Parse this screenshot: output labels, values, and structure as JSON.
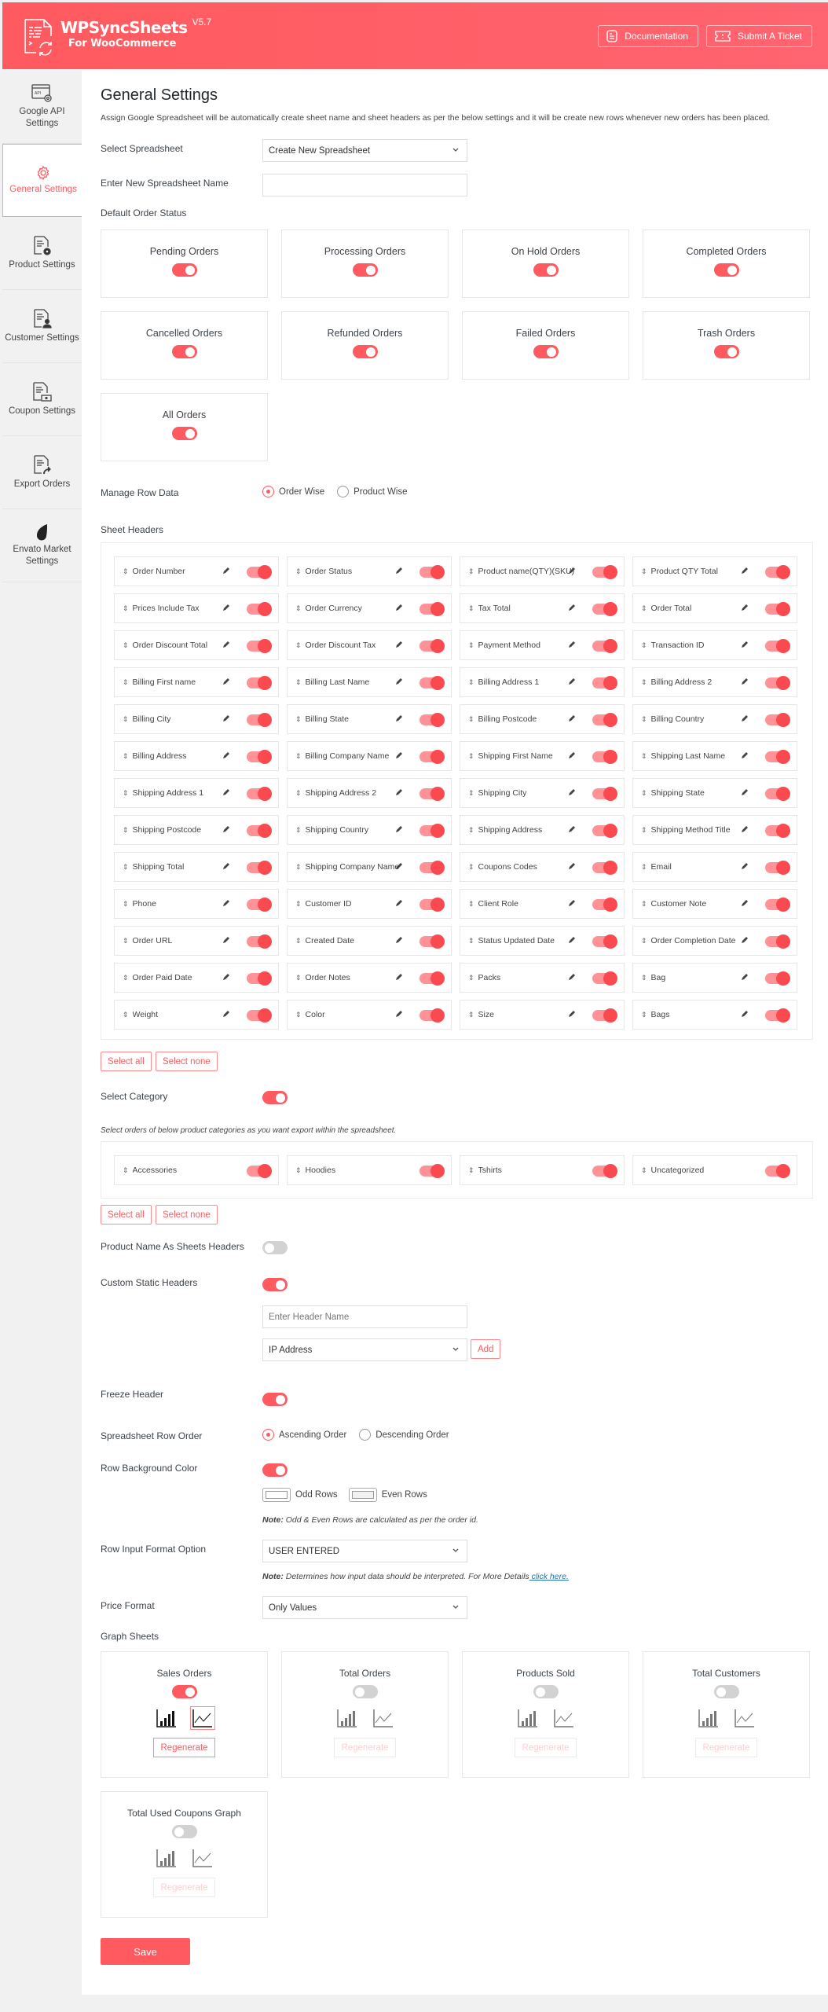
{
  "header": {
    "brand": "WPSyncSheets",
    "subtitle": "For WooCommerce",
    "version": "V5.7",
    "documentation_label": "Documentation",
    "ticket_label": "Submit A Ticket",
    "accent_color": "#ff5a5f"
  },
  "sidebar": {
    "items": [
      {
        "label": "Google API Settings",
        "icon": "api-settings-icon",
        "active": false
      },
      {
        "label": "General Settings",
        "icon": "gear-icon",
        "active": true
      },
      {
        "label": "Product Settings",
        "icon": "product-doc-icon",
        "active": false
      },
      {
        "label": "Customer Settings",
        "icon": "customer-doc-icon",
        "active": false
      },
      {
        "label": "Coupon Settings",
        "icon": "coupon-doc-icon",
        "active": false
      },
      {
        "label": "Export Orders",
        "icon": "export-doc-icon",
        "active": false
      },
      {
        "label": "Envato Market Settings",
        "icon": "envato-leaf-icon",
        "active": false
      }
    ]
  },
  "main": {
    "title": "General Settings",
    "description": "Assign Google Spreadsheet will be automatically create sheet name and sheet headers as per the below settings and it will be create new rows whenever new orders has been placed.",
    "select_spreadsheet": {
      "label": "Select Spreadsheet",
      "value": "Create New Spreadsheet"
    },
    "new_spreadsheet_name": {
      "label": "Enter New Spreadsheet Name",
      "value": ""
    },
    "default_order_status": {
      "label": "Default Order Status",
      "items": [
        {
          "label": "Pending Orders",
          "on": true
        },
        {
          "label": "Processing Orders",
          "on": true
        },
        {
          "label": "On Hold Orders",
          "on": true
        },
        {
          "label": "Completed Orders",
          "on": true
        },
        {
          "label": "Cancelled Orders",
          "on": true
        },
        {
          "label": "Refunded Orders",
          "on": true
        },
        {
          "label": "Failed Orders",
          "on": true
        },
        {
          "label": "Trash Orders",
          "on": true
        },
        {
          "label": "All Orders",
          "on": true
        }
      ]
    },
    "manage_row_data": {
      "label": "Manage Row Data",
      "options": [
        "Order Wise",
        "Product Wise"
      ],
      "selected": "Order Wise"
    },
    "sheet_headers": {
      "label": "Sheet Headers",
      "items": [
        "Order Number",
        "Order Status",
        "Product name(QTY)(SKU)",
        "Product QTY Total",
        "Prices Include Tax",
        "Order Currency",
        "Tax Total",
        "Order Total",
        "Order Discount Total",
        "Order Discount Tax",
        "Payment Method",
        "Transaction ID",
        "Billing First name",
        "Billing Last Name",
        "Billing Address 1",
        "Billing Address 2",
        "Billing City",
        "Billing State",
        "Billing Postcode",
        "Billing Country",
        "Billing Address",
        "Billing Company Name",
        "Shipping First Name",
        "Shipping Last Name",
        "Shipping Address 1",
        "Shipping Address 2",
        "Shipping City",
        "Shipping State",
        "Shipping Postcode",
        "Shipping Country",
        "Shipping Address",
        "Shipping Method Title",
        "Shipping Total",
        "Shipping Company Name",
        "Coupons Codes",
        "Email",
        "Phone",
        "Customer ID",
        "Client Role",
        "Customer Note",
        "Order URL",
        "Created Date",
        "Status Updated Date",
        "Order Completion Date",
        "Order Paid Date",
        "Order Notes",
        "Packs",
        "Bag",
        "Weight",
        "Color",
        "Size",
        "Bags"
      ],
      "all_enabled": true,
      "select_all_label": "Select all",
      "select_none_label": "Select none"
    },
    "select_category": {
      "label": "Select Category",
      "on": true,
      "note": "Select orders of below product categories as you want export within the spreadsheet.",
      "items": [
        "Accessories",
        "Hoodies",
        "Tshirts",
        "Uncategorized"
      ],
      "select_all_label": "Select all",
      "select_none_label": "Select none"
    },
    "product_name_headers": {
      "label": "Product Name As Sheets Headers",
      "on": false
    },
    "custom_static_headers": {
      "label": "Custom Static Headers",
      "on": true,
      "header_name_placeholder": "Enter Header Name",
      "type_value": "IP Address",
      "add_label": "Add"
    },
    "freeze_header": {
      "label": "Freeze Header",
      "on": true
    },
    "row_order": {
      "label": "Spreadsheet Row Order",
      "options": [
        "Ascending Order",
        "Descending Order"
      ],
      "selected": "Ascending Order"
    },
    "row_background": {
      "label": "Row Background Color",
      "on": true,
      "odd_label": "Odd Rows",
      "even_label": "Even Rows",
      "odd_color": "#ffffff",
      "even_color": "#f1f1f1",
      "note_prefix": "Note:",
      "note_text": " Odd & Even Rows are calculated as per the order id."
    },
    "row_input_format": {
      "label": "Row Input Format Option",
      "value": "USER ENTERED",
      "note_prefix": "Note:",
      "note_text": " Determines how input data should be interpreted. For More Details",
      "note_link": " click here."
    },
    "price_format": {
      "label": "Price Format",
      "value": "Only Values"
    },
    "graph_sheets": {
      "label": "Graph Sheets",
      "regenerate_label": "Regenerate",
      "items": [
        {
          "label": "Sales Orders",
          "on": true,
          "selected_chart": "line"
        },
        {
          "label": "Total Orders",
          "on": false,
          "selected_chart": ""
        },
        {
          "label": "Products Sold",
          "on": false,
          "selected_chart": ""
        },
        {
          "label": "Total Customers",
          "on": false,
          "selected_chart": ""
        },
        {
          "label": "Total Used Coupons Graph",
          "on": false,
          "selected_chart": ""
        }
      ]
    },
    "save_label": "Save"
  }
}
